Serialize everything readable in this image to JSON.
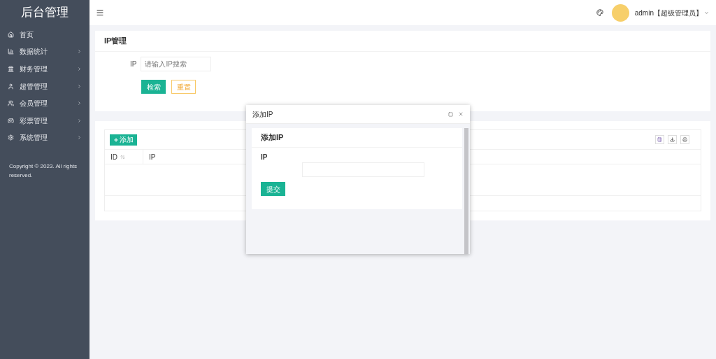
{
  "sidebar": {
    "title": "后台管理",
    "items": [
      {
        "label": "首页",
        "has_children": false
      },
      {
        "label": "数据统计",
        "has_children": true
      },
      {
        "label": "财务管理",
        "has_children": true
      },
      {
        "label": "超管管理",
        "has_children": true
      },
      {
        "label": "会员管理",
        "has_children": true
      },
      {
        "label": "彩票管理",
        "has_children": true
      },
      {
        "label": "系统管理",
        "has_children": true
      }
    ],
    "footer": "Copyright © 2023. All rights reserved."
  },
  "header": {
    "user": "admin【超级管理员】"
  },
  "search_panel": {
    "title": "IP管理",
    "field_label": "IP",
    "placeholder": "请输入IP搜索",
    "buttons": [
      "检索",
      "重置"
    ]
  },
  "table": {
    "add_button": "添加",
    "columns": [
      {
        "label": "ID",
        "sortable": true
      },
      {
        "label": "IP",
        "sortable": false
      }
    ]
  },
  "dialog": {
    "title": "添加IP",
    "panel_title": "添加IP",
    "field_label": "IP",
    "submit": "提交"
  }
}
